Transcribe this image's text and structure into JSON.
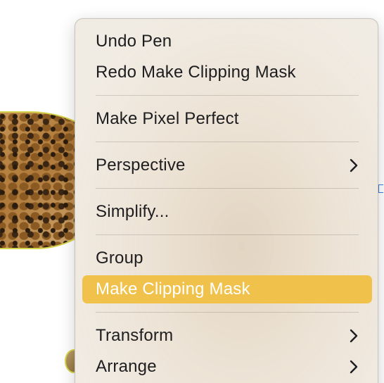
{
  "menu": {
    "items": [
      {
        "label": "Undo Pen",
        "has_submenu": false,
        "highlighted": false
      },
      {
        "label": "Redo Make Clipping Mask",
        "has_submenu": false,
        "highlighted": false
      },
      {
        "label": "Make Pixel Perfect",
        "has_submenu": false,
        "highlighted": false
      },
      {
        "label": "Perspective",
        "has_submenu": true,
        "highlighted": false
      },
      {
        "label": "Simplify...",
        "has_submenu": false,
        "highlighted": false
      },
      {
        "label": "Group",
        "has_submenu": false,
        "highlighted": false
      },
      {
        "label": "Make Clipping Mask",
        "has_submenu": false,
        "highlighted": true
      },
      {
        "label": "Transform",
        "has_submenu": true,
        "highlighted": false
      },
      {
        "label": "Arrange",
        "has_submenu": true,
        "highlighted": false
      }
    ],
    "submenu_icon": "chevron-right-icon"
  },
  "colors": {
    "highlight": "#f0c24b",
    "selection_outline": "#d4d44a",
    "text": "#1d1d1f"
  }
}
